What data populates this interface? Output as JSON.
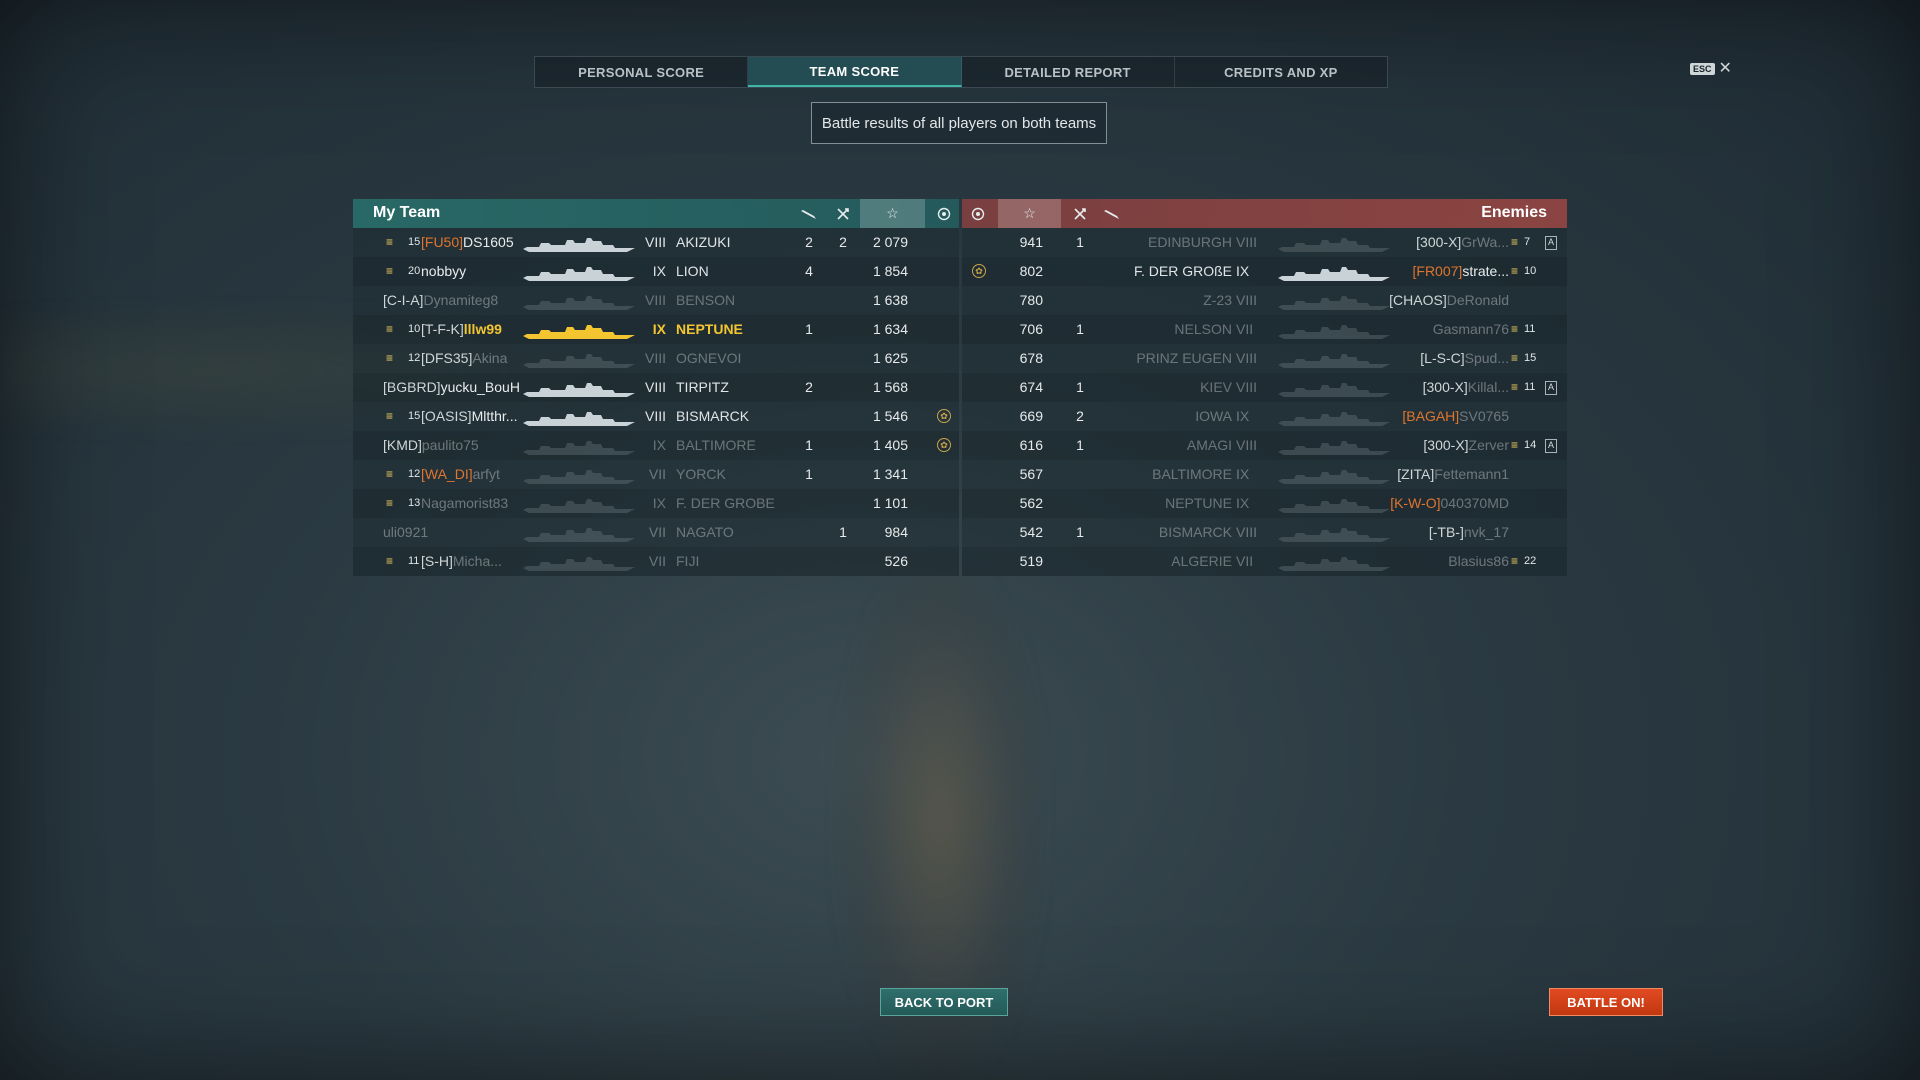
{
  "tabs": [
    {
      "label": "PERSONAL SCORE",
      "active": false
    },
    {
      "label": "TEAM SCORE",
      "active": true
    },
    {
      "label": "DETAILED REPORT",
      "active": false
    },
    {
      "label": "CREDITS AND XP",
      "active": false
    }
  ],
  "esc": {
    "key": "ESC",
    "close": "✕"
  },
  "subtitle": "Battle results of all players on both teams",
  "my_team": {
    "title": "My Team",
    "rows": [
      {
        "chev": "3",
        "rank": "15",
        "clan": "[FU50]",
        "clan_color": "orange",
        "player": "DS1605",
        "tier": "VIII",
        "ship": "AKIZUKI",
        "c1": "2",
        "c2": "2",
        "xp": "2 079",
        "medal": false,
        "highlight": false,
        "dead": false
      },
      {
        "chev": "1",
        "rank": "20",
        "clan": "",
        "clan_color": "",
        "player": "nobbyy",
        "tier": "IX",
        "ship": "LION",
        "c1": "4",
        "c2": "",
        "xp": "1 854",
        "medal": false,
        "highlight": false,
        "dead": false
      },
      {
        "chev": "",
        "rank": "",
        "clan": "[C-I-A]",
        "clan_color": "",
        "player": "Dynamiteg8",
        "tier": "VIII",
        "ship": "BENSON",
        "c1": "",
        "c2": "",
        "xp": "1 638",
        "medal": false,
        "highlight": false,
        "dead": true
      },
      {
        "chev": "2",
        "rank": "10",
        "clan": "[T-F-K]",
        "clan_color": "",
        "player": "lllw99",
        "tier": "IX",
        "ship": "NEPTUNE",
        "c1": "1",
        "c2": "",
        "xp": "1 634",
        "medal": false,
        "highlight": true,
        "dead": false
      },
      {
        "chev": "3",
        "rank": "12",
        "clan": "[DFS35]",
        "clan_color": "",
        "player": "Akina",
        "tier": "VIII",
        "ship": "OGNEVOI",
        "c1": "",
        "c2": "",
        "xp": "1 625",
        "medal": false,
        "highlight": false,
        "dead": true
      },
      {
        "chev": "",
        "rank": "",
        "clan": "[BGBRD]",
        "clan_color": "",
        "player": "yucku_BouH",
        "tier": "VIII",
        "ship": "TIRPITZ",
        "c1": "2",
        "c2": "",
        "xp": "1 568",
        "medal": false,
        "highlight": false,
        "dead": false
      },
      {
        "chev": "2",
        "rank": "15",
        "clan": "[OASIS]",
        "clan_color": "",
        "player": "Mltthr...",
        "tier": "VIII",
        "ship": "BISMARCK",
        "c1": "",
        "c2": "",
        "xp": "1 546",
        "medal": true,
        "highlight": false,
        "dead": false
      },
      {
        "chev": "",
        "rank": "",
        "clan": "[KMD]",
        "clan_color": "",
        "player": "paulito75",
        "tier": "IX",
        "ship": "BALTIMORE",
        "c1": "1",
        "c2": "",
        "xp": "1 405",
        "medal": true,
        "highlight": false,
        "dead": true
      },
      {
        "chev": "3",
        "rank": "12",
        "clan": "[WA_DI]",
        "clan_color": "orange",
        "player": "arfyt",
        "tier": "VII",
        "ship": "YORCK",
        "c1": "1",
        "c2": "",
        "xp": "1 341",
        "medal": false,
        "highlight": false,
        "dead": true
      },
      {
        "chev": "3",
        "rank": "13",
        "clan": "",
        "clan_color": "",
        "player": "Nagamorist83",
        "tier": "IX",
        "ship": "F. DER GROBE",
        "c1": "",
        "c2": "",
        "xp": "1 101",
        "medal": false,
        "highlight": false,
        "dead": true
      },
      {
        "chev": "",
        "rank": "",
        "clan": "",
        "clan_color": "",
        "player": "uli0921",
        "tier": "VII",
        "ship": "NAGATO",
        "c1": "",
        "c2": "1",
        "xp": "984",
        "medal": false,
        "highlight": false,
        "dead": true
      },
      {
        "chev": "1",
        "rank": "11",
        "clan": "[S-H]",
        "clan_color": "",
        "player": "Micha...",
        "tier": "VII",
        "ship": "FIJI",
        "c1": "",
        "c2": "",
        "xp": "526",
        "medal": false,
        "highlight": false,
        "dead": true
      }
    ]
  },
  "enemies": {
    "title": "Enemies",
    "rows": [
      {
        "xp": "941",
        "c2": "1",
        "c1": "",
        "ship": "EDINBURGH",
        "tier": "VIII",
        "clan": "[300-X]",
        "clan_color": "",
        "player": "GrWa...",
        "chev": "2",
        "rank": "7",
        "sq": true,
        "medal": false,
        "dead": true
      },
      {
        "xp": "802",
        "c2": "",
        "c1": "",
        "ship": "F. DER GROßE",
        "tier": "IX",
        "clan": "[FR007]",
        "clan_color": "orange",
        "player": "strate...",
        "chev": "2",
        "rank": "10",
        "sq": false,
        "medal": true,
        "dead": false
      },
      {
        "xp": "780",
        "c2": "",
        "c1": "",
        "ship": "Z-23",
        "tier": "VIII",
        "clan": "[CHAOS]",
        "clan_color": "",
        "player": "DeRonald",
        "chev": "",
        "rank": "",
        "sq": false,
        "medal": false,
        "dead": true
      },
      {
        "xp": "706",
        "c2": "1",
        "c1": "",
        "ship": "NELSON",
        "tier": "VII",
        "clan": "",
        "clan_color": "",
        "player": "Gasmann76",
        "chev": "1",
        "rank": "11",
        "sq": false,
        "medal": false,
        "dead": true
      },
      {
        "xp": "678",
        "c2": "",
        "c1": "",
        "ship": "PRINZ EUGEN",
        "tier": "VIII",
        "clan": "[L-S-C]",
        "clan_color": "",
        "player": "Spud...",
        "chev": "3",
        "rank": "15",
        "sq": false,
        "medal": false,
        "dead": true
      },
      {
        "xp": "674",
        "c2": "1",
        "c1": "",
        "ship": "KIEV",
        "tier": "VIII",
        "clan": "[300-X]",
        "clan_color": "",
        "player": "Killal...",
        "chev": "1",
        "rank": "11",
        "sq": true,
        "medal": false,
        "dead": true
      },
      {
        "xp": "669",
        "c2": "2",
        "c1": "",
        "ship": "IOWA",
        "tier": "IX",
        "clan": "[BAGAH]",
        "clan_color": "orange",
        "player": "SV0765",
        "chev": "",
        "rank": "",
        "sq": false,
        "medal": false,
        "dead": true
      },
      {
        "xp": "616",
        "c2": "1",
        "c1": "",
        "ship": "AMAGI",
        "tier": "VIII",
        "clan": "[300-X]",
        "clan_color": "",
        "player": "Zerver",
        "chev": "2",
        "rank": "14",
        "sq": true,
        "medal": false,
        "dead": true
      },
      {
        "xp": "567",
        "c2": "",
        "c1": "",
        "ship": "BALTIMORE",
        "tier": "IX",
        "clan": "[ZITA]",
        "clan_color": "",
        "player": "Fettemann1",
        "chev": "",
        "rank": "",
        "sq": false,
        "medal": false,
        "dead": true
      },
      {
        "xp": "562",
        "c2": "",
        "c1": "",
        "ship": "NEPTUNE",
        "tier": "IX",
        "clan": "[K-W-O]",
        "clan_color": "orange",
        "player": "040370MD",
        "chev": "",
        "rank": "",
        "sq": false,
        "medal": false,
        "dead": true
      },
      {
        "xp": "542",
        "c2": "1",
        "c1": "",
        "ship": "BISMARCK",
        "tier": "VIII",
        "clan": "[-TB-]",
        "clan_color": "",
        "player": "nvk_17",
        "chev": "",
        "rank": "",
        "sq": false,
        "medal": false,
        "dead": true
      },
      {
        "xp": "519",
        "c2": "",
        "c1": "",
        "ship": "ALGERIE",
        "tier": "VII",
        "clan": "",
        "clan_color": "",
        "player": "Blasius86",
        "chev": "4",
        "rank": "22",
        "sq": false,
        "medal": false,
        "dead": true
      }
    ]
  },
  "icons": {
    "torpedo": "torpedo-icon",
    "kill": "crossed-swords-icon",
    "star": "☆",
    "medal": "medal-icon"
  },
  "buttons": {
    "back": "BACK TO PORT",
    "battle": "BATTLE ON!"
  },
  "colors": {
    "my_team": "#2c6e6a",
    "enemies": "#8c4644",
    "highlight": "#f3c631",
    "clan_orange": "#e0752e",
    "battle_button": "#d8431b"
  }
}
